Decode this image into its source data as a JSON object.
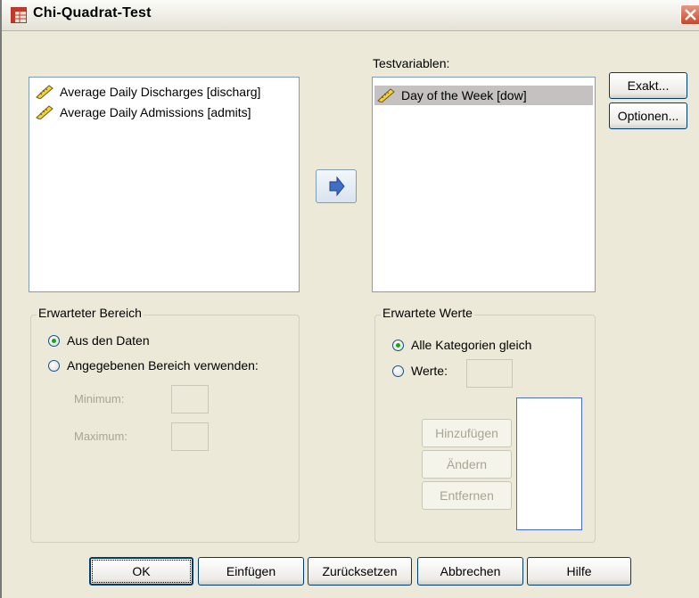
{
  "window": {
    "title": "Chi-Quadrat-Test"
  },
  "source_list": {
    "items": [
      {
        "label": "Average Daily Discharges [discharg]",
        "icon": "ruler-icon"
      },
      {
        "label": "Average Daily Admissions [admits]",
        "icon": "ruler-icon"
      }
    ]
  },
  "test_variables": {
    "label": "Testvariablen:",
    "items": [
      {
        "label": "Day of the Week [dow]",
        "icon": "ruler-icon",
        "selected": true
      }
    ]
  },
  "side_buttons": {
    "exakt": "Exakt...",
    "optionen": "Optionen..."
  },
  "expected_range": {
    "title": "Erwarteter Bereich",
    "from_data": "Aus den Daten",
    "use_range": "Angegebenen Bereich verwenden:",
    "minimum_label": "Minimum:",
    "maximum_label": "Maximum:",
    "minimum_value": "",
    "maximum_value": "",
    "selected": "from_data"
  },
  "expected_values": {
    "title": "Erwartete Werte",
    "all_equal": "Alle Kategorien gleich",
    "values": "Werte:",
    "values_input": "",
    "add": "Hinzufügen",
    "change": "Ändern",
    "remove": "Entfernen",
    "selected": "all_equal"
  },
  "footer": {
    "ok": "OK",
    "paste": "Einfügen",
    "reset": "Zurücksetzen",
    "cancel": "Abbrechen",
    "help": "Hilfe"
  },
  "colors": {
    "window_bg": "#ece9d8",
    "list_border": "#7f9db9",
    "selection": "#c4c1c0",
    "radio_dot": "#21a121",
    "close_button": "#c7462b"
  }
}
